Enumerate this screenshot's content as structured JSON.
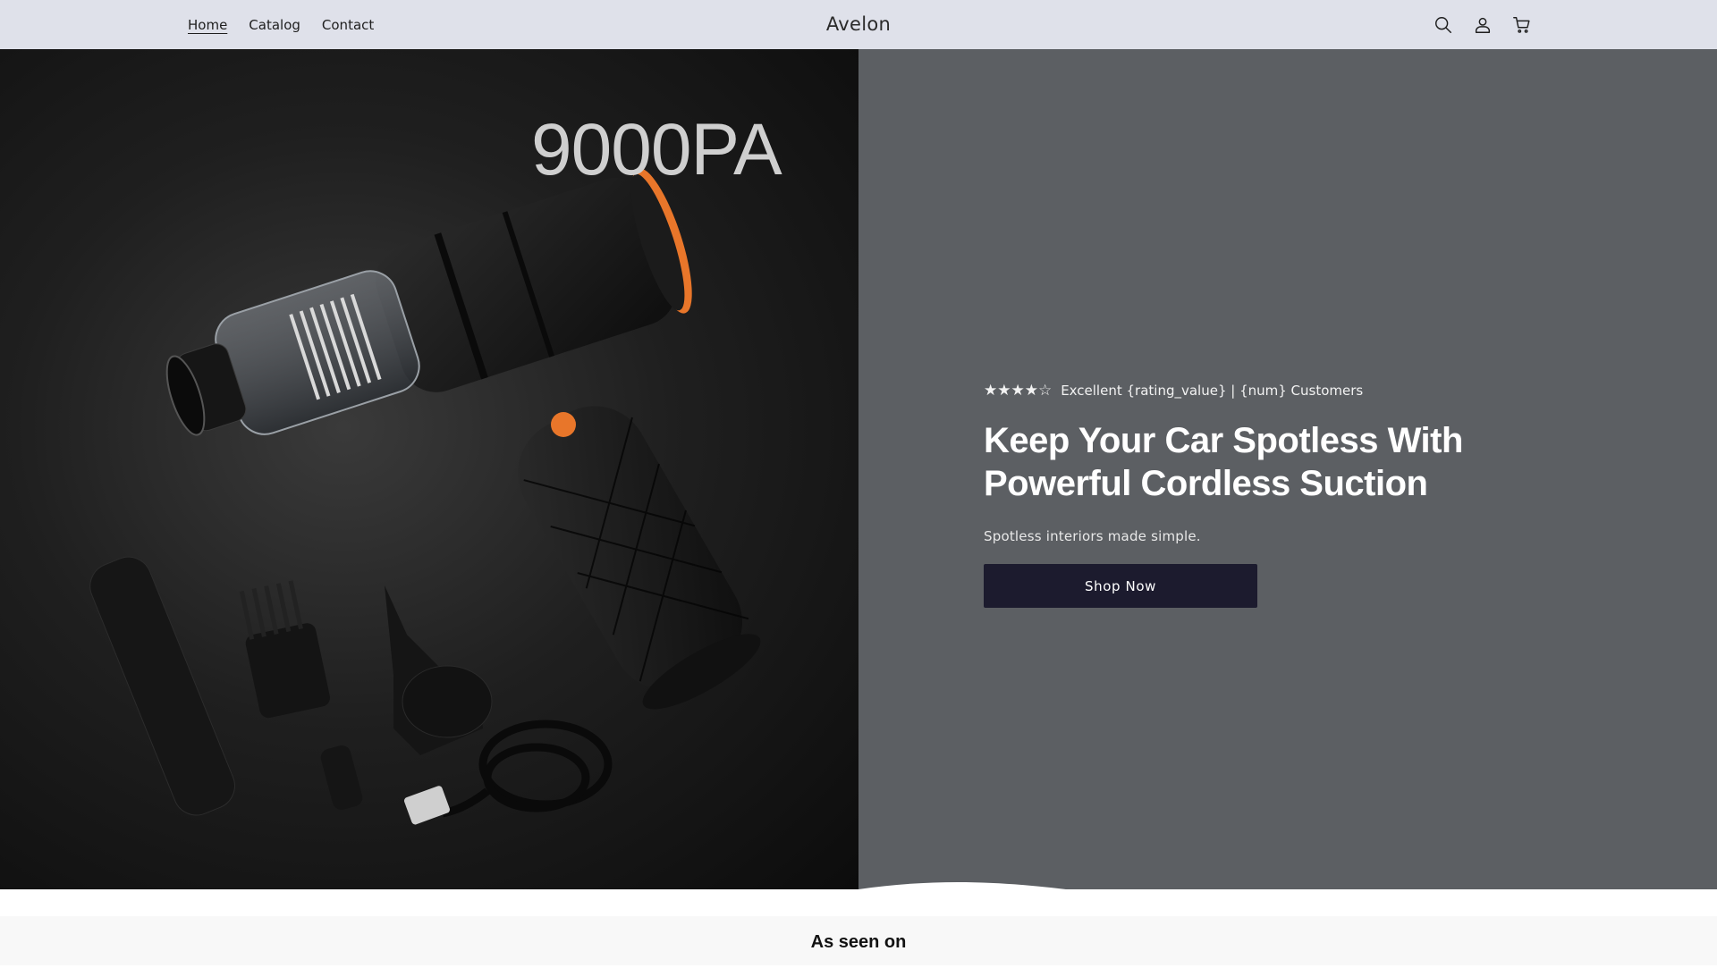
{
  "header": {
    "nav": [
      {
        "label": "Home"
      },
      {
        "label": "Catalog"
      },
      {
        "label": "Contact"
      }
    ],
    "brand": "Avelon",
    "icons": [
      "search-icon",
      "account-icon",
      "cart-icon"
    ]
  },
  "hero": {
    "image_label": "9000PA",
    "rating": {
      "stars": "★★★★☆",
      "text": "Excellent {rating_value} | {num} Customers"
    },
    "headline": "Keep Your Car Spotless With Powerful Cordless Suction",
    "subheading": "Spotless interiors made simple.",
    "cta_label": "Shop Now"
  },
  "seen_on": {
    "title": "As seen on"
  },
  "colors": {
    "header_bg": "#dfe1ea",
    "hero_right_bg": "#5c5f63",
    "cta_bg": "#1c1b2e",
    "accent_orange": "#e8762a"
  }
}
